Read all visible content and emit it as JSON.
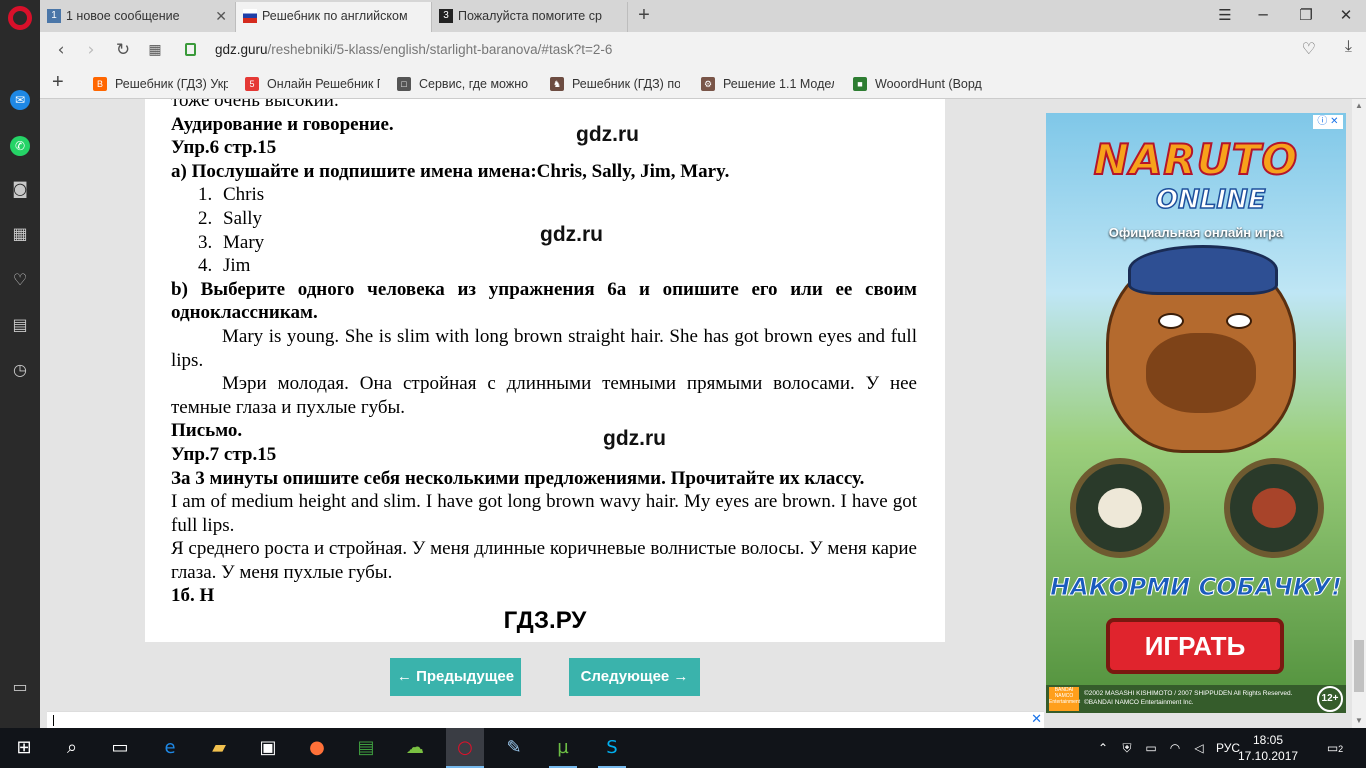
{
  "tabs": [
    {
      "label": "1 новое сообщение",
      "favicon_text": "1",
      "favicon_color": "#4a76a8"
    },
    {
      "label": "Решебник по английском",
      "favicon_text": "",
      "favicon_color": "#1f3fa8"
    },
    {
      "label": "Пожалуйста помогите ср",
      "favicon_text": "3",
      "favicon_color": "#222222"
    }
  ],
  "address": {
    "host": "gdz.guru",
    "path": "/reshebniki/5-klass/english/starlight-baranova/#task?t=2-6"
  },
  "bookmarks": [
    {
      "label": "Решебник (ГДЗ) Укр",
      "icon_text": "B",
      "icon_color": "#ff6600"
    },
    {
      "label": "Онлайн Решебник Г",
      "icon_text": "5",
      "icon_color": "#e53935"
    },
    {
      "label": "Сервис, где можно",
      "icon_text": "□",
      "icon_color": "#555555"
    },
    {
      "label": "Решебник (ГДЗ) по",
      "icon_text": "♞",
      "icon_color": "#6d4c41"
    },
    {
      "label": "Решение 1.1 Модел",
      "icon_text": "⚙",
      "icon_color": "#795548"
    },
    {
      "label": "WooordHunt (Ворд",
      "icon_text": "■",
      "icon_color": "#2e7d32"
    }
  ],
  "document": {
    "line_top": "тоже очень высокий.",
    "section1": "Аудирование и говорение.",
    "ex6": "Упр.6 стр.15",
    "ex6a": "a) Послушайте и подпишите имена имена:Chris, Sally, Jim, Mary.",
    "list": [
      {
        "n": "1.",
        "text": "Chris"
      },
      {
        "n": "2.",
        "text": "Sally"
      },
      {
        "n": "3.",
        "text": "Mary"
      },
      {
        "n": "4.",
        "text": "Jim"
      }
    ],
    "ex6b": "b) Выберите одного человека из упражнения 6а и опишите его или ее своим одноклассникам.",
    "en1": "Mary is young. She is slim with long brown straight hair. She has got brown eyes and full lips.",
    "ru1": "Мэри молодая. Она стройная с длинными темными прямыми волосами. У нее темные глаза и пухлые губы.",
    "section2": "Письмо.",
    "ex7": "Упр.7 стр.15",
    "ex7task": "За 3 минуты опишите себя несколькими предложениями. Прочитайте их классу.",
    "en2": "I am of medium height and slim. I have got long brown wavy hair. My eyes are brown. I have got full lips.",
    "ru2": "Я среднего роста и стройная. У меня длинные коричневые волнистые волосы. У меня карие глаза. У меня пухлые губы.",
    "cut": "1б. Н",
    "watermark": "gdz.ru",
    "footer_brand": "ГДЗ.РУ"
  },
  "pager": {
    "prev": "← Предыдущее",
    "next": "Следующее →",
    "color": "#3ab3ac"
  },
  "ad": {
    "logo_line1": "NARUTO",
    "logo_line2": "ONLINE",
    "subtitle": "Официальная онлайн игра",
    "cta_title": "НАКОРМИ СОБАЧКУ!",
    "play": "ИГРАТЬ",
    "legal": "©2002 MASASHI KISHIMOTO / 2007 SHIPPUDEN  All Rights Reserved. ©BANDAI NAMCO Entertainment Inc.",
    "badge": "BANDAI NAMCO Entertainment",
    "age": "12+"
  },
  "taskbar": {
    "lang": "РУС",
    "time": "18:05",
    "date": "17.10.2017",
    "notif_count": "2"
  }
}
